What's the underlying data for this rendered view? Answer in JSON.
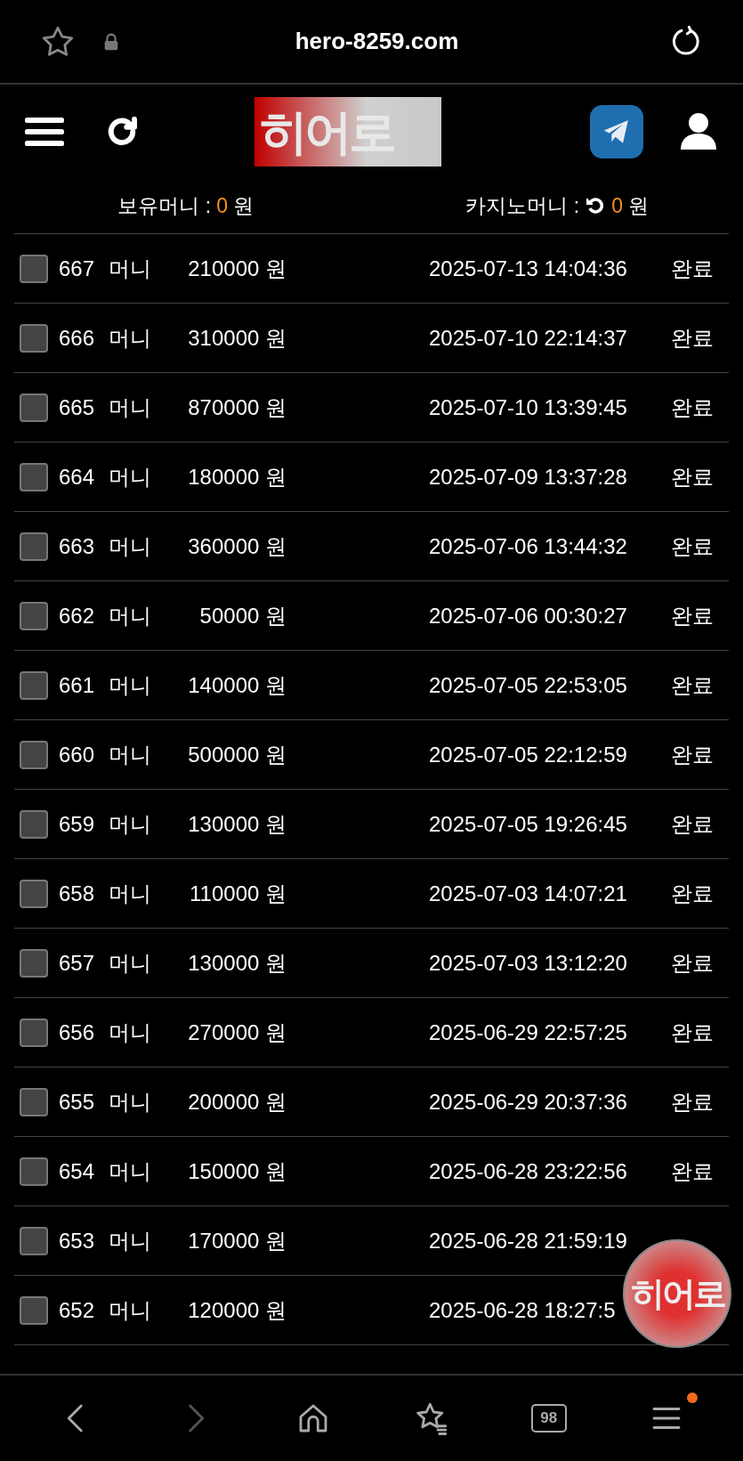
{
  "browser_bar": {
    "url": "hero-8259.com"
  },
  "header": {
    "logo": "히어로"
  },
  "balance": {
    "held_label": "보유머니 :",
    "held_value": "0",
    "held_unit": "원",
    "casino_label": "카지노머니 :",
    "casino_value": "0",
    "casino_unit": "원"
  },
  "rows": [
    {
      "number": "667",
      "type": "머니",
      "amount": "210000 원",
      "datetime": "2025-07-13 14:04:36",
      "status": "완료",
      "checked": false
    },
    {
      "number": "666",
      "type": "머니",
      "amount": "310000 원",
      "datetime": "2025-07-10 22:14:37",
      "status": "완료",
      "checked": false
    },
    {
      "number": "665",
      "type": "머니",
      "amount": "870000 원",
      "datetime": "2025-07-10 13:39:45",
      "status": "완료",
      "checked": false
    },
    {
      "number": "664",
      "type": "머니",
      "amount": "180000 원",
      "datetime": "2025-07-09 13:37:28",
      "status": "완료",
      "checked": false
    },
    {
      "number": "663",
      "type": "머니",
      "amount": "360000 원",
      "datetime": "2025-07-06 13:44:32",
      "status": "완료",
      "checked": false
    },
    {
      "number": "662",
      "type": "머니",
      "amount": "50000 원",
      "datetime": "2025-07-06 00:30:27",
      "status": "완료",
      "checked": false
    },
    {
      "number": "661",
      "type": "머니",
      "amount": "140000 원",
      "datetime": "2025-07-05 22:53:05",
      "status": "완료",
      "checked": false
    },
    {
      "number": "660",
      "type": "머니",
      "amount": "500000 원",
      "datetime": "2025-07-05 22:12:59",
      "status": "완료",
      "checked": false
    },
    {
      "number": "659",
      "type": "머니",
      "amount": "130000 원",
      "datetime": "2025-07-05 19:26:45",
      "status": "완료",
      "checked": false
    },
    {
      "number": "658",
      "type": "머니",
      "amount": "110000 원",
      "datetime": "2025-07-03 14:07:21",
      "status": "완료",
      "checked": false
    },
    {
      "number": "657",
      "type": "머니",
      "amount": "130000 원",
      "datetime": "2025-07-03 13:12:20",
      "status": "완료",
      "checked": false
    },
    {
      "number": "656",
      "type": "머니",
      "amount": "270000 원",
      "datetime": "2025-06-29 22:57:25",
      "status": "완료",
      "checked": false
    },
    {
      "number": "655",
      "type": "머니",
      "amount": "200000 원",
      "datetime": "2025-06-29 20:37:36",
      "status": "완료",
      "checked": false
    },
    {
      "number": "654",
      "type": "머니",
      "amount": "150000 원",
      "datetime": "2025-06-28 23:22:56",
      "status": "완료",
      "checked": false
    },
    {
      "number": "653",
      "type": "머니",
      "amount": "170000 원",
      "datetime": "2025-06-28 21:59:19",
      "checked": false
    },
    {
      "number": "652",
      "type": "머니",
      "amount": "120000 원",
      "datetime": "2025-06-28 18:27:5",
      "checked": false
    }
  ],
  "floating_button": {
    "label": "히어로"
  },
  "nav": {
    "tabs_count": "98",
    "notification": true
  }
}
